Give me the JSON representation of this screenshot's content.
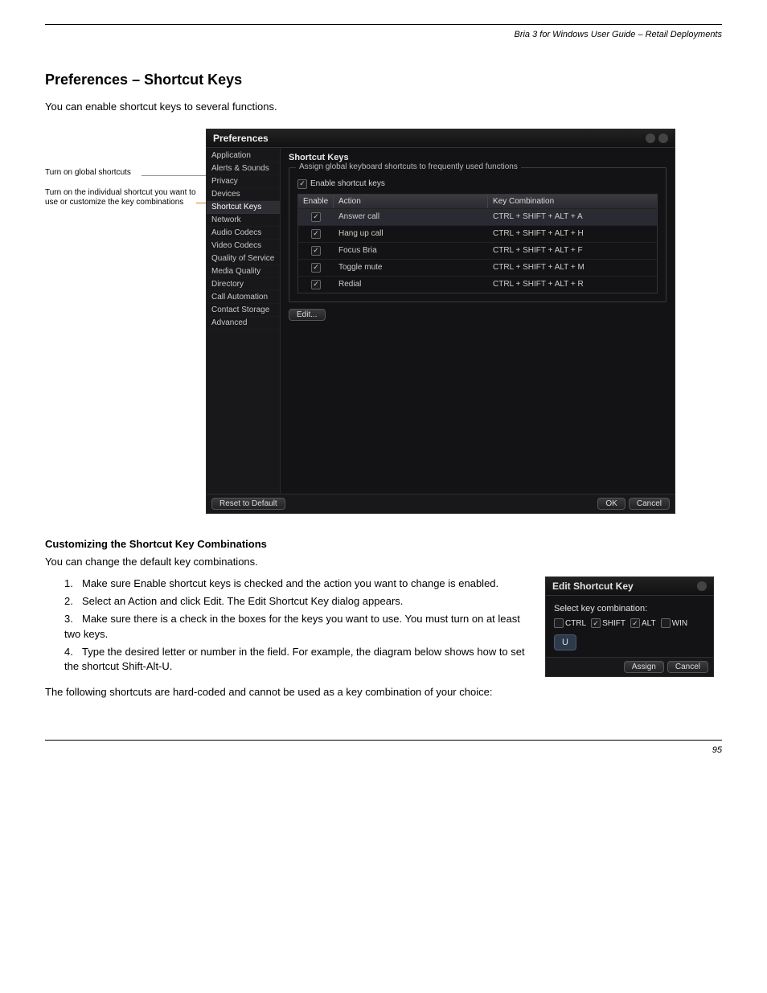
{
  "doc": {
    "header_right": "Bria 3 for Windows User Guide – Retail Deployments",
    "section_title": "Preferences – Shortcut Keys",
    "intro": "You can enable shortcut keys to several functions.",
    "callouts": {
      "a": "Turn on global shortcuts",
      "b": "Turn on the individual shortcut you want to use or customize the key combinations"
    },
    "customize_heading": "Customizing the Shortcut Key Combinations",
    "customize_intro": "You can change the default key combinations.",
    "steps": [
      "Make sure Enable shortcut keys is checked and the action you want to change is enabled.",
      "Select an Action and click Edit. The Edit Shortcut Key dialog appears.",
      "Make sure there is a check in the boxes for the keys you want to use. You must turn on at least two keys.",
      "Type the desired letter or number in the field. For example, the diagram below shows how to set the shortcut Shift-Alt-U."
    ],
    "note": "The following shortcuts are hard-coded and cannot be used as a key combination of your choice:",
    "page_number": "95"
  },
  "pref": {
    "title": "Preferences",
    "sidebar": [
      "Application",
      "Alerts & Sounds",
      "Privacy",
      "Devices",
      "Shortcut Keys",
      "Network",
      "Audio Codecs",
      "Video Codecs",
      "Quality of Service",
      "Media Quality",
      "Directory",
      "Call Automation",
      "Contact Storage",
      "Advanced"
    ],
    "active_index": 4,
    "main_title": "Shortcut Keys",
    "legend": "Assign global keyboard shortcuts to frequently used functions",
    "enable_label": "Enable shortcut keys",
    "headers": {
      "enable": "Enable",
      "action": "Action",
      "combo": "Key Combination"
    },
    "rows": [
      {
        "action": "Answer call",
        "combo": "CTRL + SHIFT + ALT + A",
        "checked": true,
        "selected": true
      },
      {
        "action": "Hang up call",
        "combo": "CTRL + SHIFT + ALT + H",
        "checked": true,
        "selected": false
      },
      {
        "action": "Focus Bria",
        "combo": "CTRL + SHIFT + ALT + F",
        "checked": true,
        "selected": false
      },
      {
        "action": "Toggle mute",
        "combo": "CTRL + SHIFT + ALT + M",
        "checked": true,
        "selected": false
      },
      {
        "action": "Redial",
        "combo": "CTRL + SHIFT + ALT + R",
        "checked": true,
        "selected": false
      }
    ],
    "edit_btn": "Edit...",
    "reset_btn": "Reset to Default",
    "ok_btn": "OK",
    "cancel_btn": "Cancel"
  },
  "editdlg": {
    "title": "Edit Shortcut Key",
    "prompt": "Select key combination:",
    "keys": [
      {
        "label": "CTRL",
        "checked": false
      },
      {
        "label": "SHIFT",
        "checked": true
      },
      {
        "label": "ALT",
        "checked": true
      },
      {
        "label": "WIN",
        "checked": false
      }
    ],
    "char": "U",
    "assign_btn": "Assign",
    "cancel_btn": "Cancel"
  }
}
